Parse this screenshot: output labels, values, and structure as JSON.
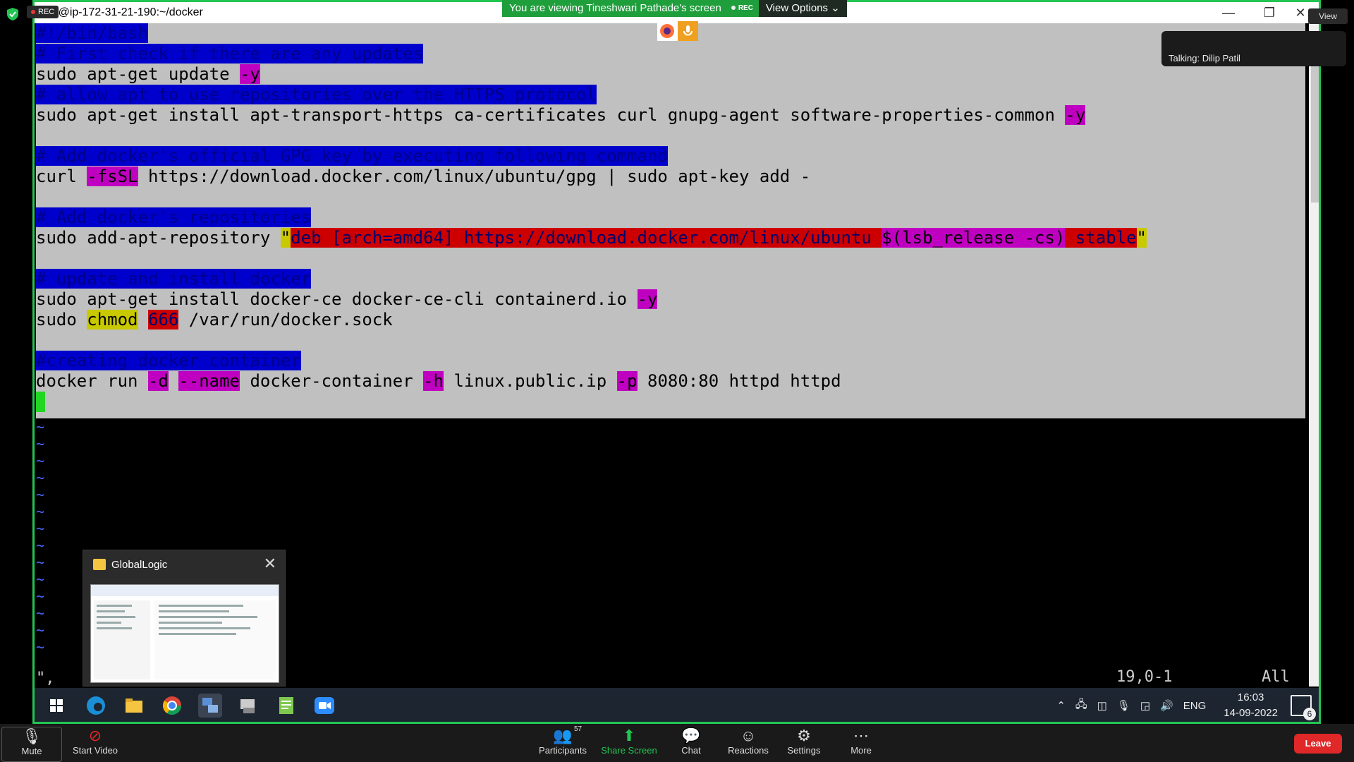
{
  "rec_label": "REC",
  "titlebar": {
    "title": "root@ip-172-31-21-190:~/docker",
    "minimize": "—",
    "restore": "❐",
    "close": "✕"
  },
  "banner": {
    "text": "You are viewing Tineshwari Pathade's screen",
    "rec": "REC",
    "view_options": "View Options ⌄"
  },
  "talking": "Talking: Dilip Patil",
  "view_button": "View",
  "terminal": {
    "l1": "#!/bin/bash",
    "l2": "# First check if there are any updates",
    "l3a": "sudo apt-get update ",
    "l3b": "-y",
    "l4": "# allow apt to use repositories over the HTTPS protocol",
    "l5a": "sudo apt-get install apt-transport-https ca-certificates curl gnupg-agent software-properties-common ",
    "l5b": "-y",
    "l7": "# Add docker's official GPG key by executing following command",
    "l8a": "curl ",
    "l8b": "-fsSL",
    "l8c": " https://download.docker.com/linux/ubuntu/gpg | sudo apt-key add -",
    "l10": "# Add docker's repositories",
    "l11a": "sudo add-apt-repository ",
    "l11b": "\"",
    "l11c": "deb [arch=amd64] https://download.docker.com/linux/ubuntu ",
    "l11d": "$(lsb_release -cs)",
    "l11e": " stable",
    "l11f": "\"",
    "l13": "# update and install docker",
    "l14a": "sudo apt-get install docker-ce docker-ce-cli containerd.io ",
    "l14b": "-y",
    "l15a": "sudo ",
    "l15b": "chmod",
    "l15c": " ",
    "l15d": "666",
    "l15e": " /var/run/docker.sock",
    "l17": "#creating docker container",
    "l18a": "docker run ",
    "l18b": "-d",
    "l18c": " ",
    "l18d": "--name",
    "l18e": " docker-container ",
    "l18f": "-h",
    "l18g": " linux.public.ip ",
    "l18h": "-p",
    "l18i": " 8080:80 httpd httpd",
    "tilde": "~",
    "status_left": "\",",
    "position": "19,0-1",
    "scroll_pos": "All"
  },
  "preview": {
    "title": "GlobalLogic",
    "close": "✕"
  },
  "tray": {
    "lang": "ENG",
    "time": "16:03",
    "date": "14-09-2022",
    "notifications": "6"
  },
  "zoom_bar": {
    "mute": "Mute",
    "start_video": "Start Video",
    "participants": "Participants",
    "participants_count": "57",
    "share_screen": "Share Screen",
    "chat": "Chat",
    "reactions": "Reactions",
    "settings": "Settings",
    "more": "More",
    "leave": "Leave"
  },
  "colors": {
    "accent_green": "#23c552",
    "leave_red": "#e02828",
    "terminal_bg": "#c0c0c0"
  }
}
